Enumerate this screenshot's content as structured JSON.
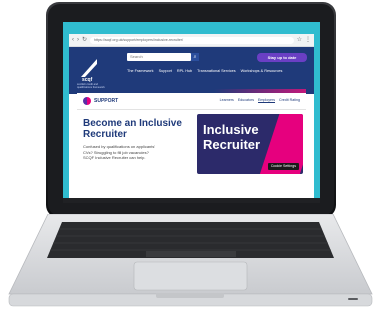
{
  "browser": {
    "url": "https://scqf.org.uk/support/employers/inclusive-recruiter/"
  },
  "site": {
    "search_placeholder": "Search",
    "stay_up_label": "Stay up to date",
    "nav": [
      "The Framework",
      "Support",
      "RPL Hub",
      "Transnational Services",
      "Workshops & Resources"
    ],
    "logo_caption": "scottish credit and qualifications framework"
  },
  "support": {
    "title": "SUPPORT",
    "subnav": [
      "Learners",
      "Educators",
      "Employers",
      "Credit Rating"
    ]
  },
  "content": {
    "headline": "Become an Inclusive Recruiter",
    "body": "Confused by qualifications on applicants' CVs? Struggling to fill job vacancies? SCQF Inclusive Recruiter can help.",
    "hero_title": "Inclusive Recruiter",
    "cookie_label": "Cookie Settings"
  },
  "colors": {
    "navy": "#1f3a7a",
    "magenta": "#e6007e",
    "purple": "#6a3fc4",
    "screen_bg": "#30bccf"
  }
}
